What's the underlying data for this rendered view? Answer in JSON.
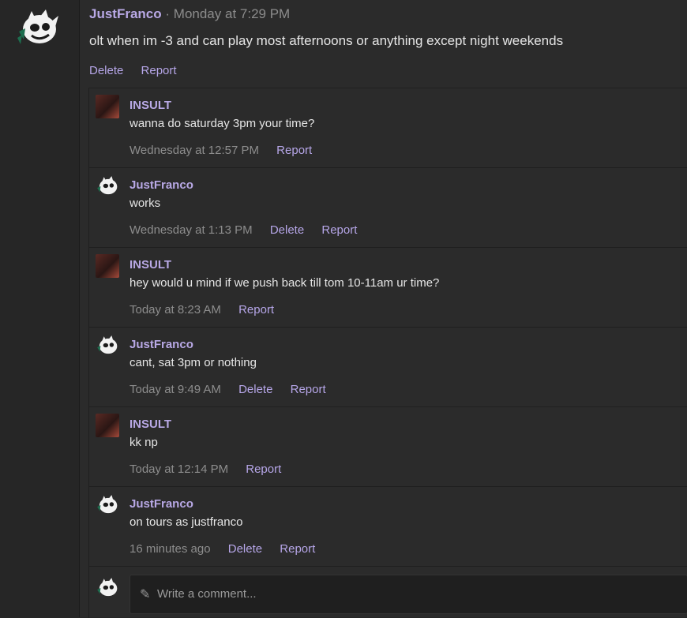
{
  "post": {
    "author": "JustFranco",
    "separator": "·",
    "time": "Monday at 7:29 PM",
    "text": "olt when im -3 and can play most afternoons or anything except night weekends",
    "actions": {
      "delete": "Delete",
      "report": "Report"
    }
  },
  "comments": [
    {
      "author": "INSULT",
      "text": "wanna do saturday 3pm your time?",
      "time": "Wednesday at 12:57 PM",
      "report": "Report"
    },
    {
      "author": "JustFranco",
      "text": "works",
      "time": "Wednesday at 1:13 PM",
      "delete": "Delete",
      "report": "Report"
    },
    {
      "author": "INSULT",
      "text": "hey would u mind if we push back till tom 10-11am ur time?",
      "time": "Today at 8:23 AM",
      "report": "Report"
    },
    {
      "author": "JustFranco",
      "text": "cant, sat 3pm or nothing",
      "time": "Today at 9:49 AM",
      "delete": "Delete",
      "report": "Report"
    },
    {
      "author": "INSULT",
      "text": "kk np",
      "time": "Today at 12:14 PM",
      "report": "Report"
    },
    {
      "author": "JustFranco",
      "text": "on tours as justfranco",
      "time": "16 minutes ago",
      "delete": "Delete",
      "report": "Report"
    }
  ],
  "compose": {
    "placeholder": "Write a comment..."
  },
  "icons": {
    "mascot": "mascot-avatar-icon",
    "pencil": "pencil-icon"
  },
  "colors": {
    "username": "#b9a9e6",
    "link": "#b6a6e8",
    "background": "#2b2b2b"
  }
}
